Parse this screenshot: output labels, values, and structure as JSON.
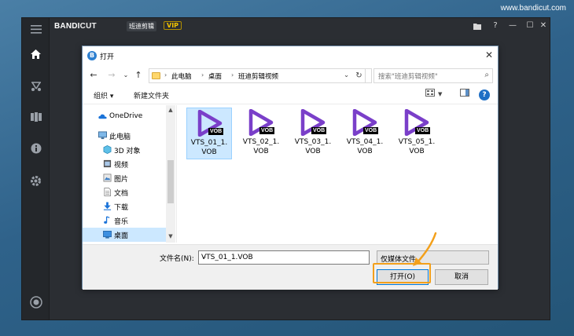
{
  "watermark": "www.bandicut.com",
  "app": {
    "brand": "BANDI",
    "brand_cut": "CUT",
    "brand_sub": "班迪剪辑",
    "vip": "VIP",
    "window_controls": [
      "folder-icon",
      "help-icon",
      "minimize-icon",
      "maximize-icon",
      "close-icon"
    ],
    "sidebar_icons": [
      "menu-icon",
      "home-icon",
      "cut-icon",
      "join-icon",
      "info-icon",
      "settings-icon",
      "record-icon"
    ]
  },
  "dialog": {
    "title": "打开",
    "address": [
      "此电脑",
      "桌面",
      "班迪剪辑视频"
    ],
    "search_placeholder": "搜索\"班迪剪辑视频\"",
    "toolbar": {
      "organize": "组织 ▾",
      "new_folder": "新建文件夹"
    },
    "tree": [
      {
        "label": "OneDrive",
        "icon": "cloud-icon"
      },
      {
        "label": "此电脑",
        "icon": "computer-icon"
      },
      {
        "label": "3D 对象",
        "icon": "cube-icon"
      },
      {
        "label": "视频",
        "icon": "video-icon"
      },
      {
        "label": "图片",
        "icon": "picture-icon"
      },
      {
        "label": "文档",
        "icon": "document-icon"
      },
      {
        "label": "下载",
        "icon": "download-icon"
      },
      {
        "label": "音乐",
        "icon": "music-icon"
      },
      {
        "label": "桌面",
        "icon": "desktop-icon",
        "selected": true
      }
    ],
    "files": [
      {
        "line1": "VTS_01_1.",
        "line2": "VOB",
        "badge": "VOB",
        "selected": true
      },
      {
        "line1": "VTS_02_1.",
        "line2": "VOB",
        "badge": "VOB"
      },
      {
        "line1": "VTS_03_1.",
        "line2": "VOB",
        "badge": "VOB"
      },
      {
        "line1": "VTS_04_1.",
        "line2": "VOB",
        "badge": "VOB"
      },
      {
        "line1": "VTS_05_1.",
        "line2": "VOB",
        "badge": "VOB"
      }
    ],
    "filename_label": "文件名(N):",
    "filename_value": "VTS_01_1.VOB",
    "filetype": "仅媒体文件",
    "open_button": "打开(O)",
    "cancel_button": "取消"
  },
  "colors": {
    "accent": "#7a3fc9",
    "highlight": "#f3a01b"
  }
}
